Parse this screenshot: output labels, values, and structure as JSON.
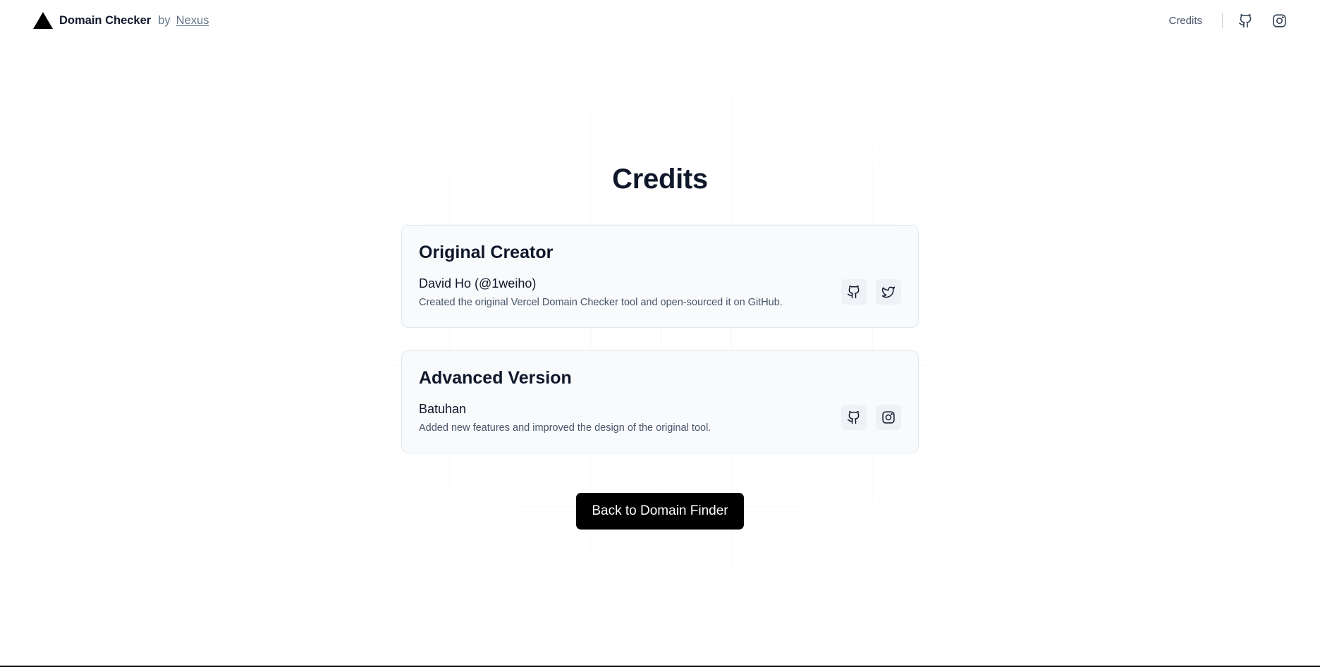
{
  "header": {
    "app_name": "Domain Checker",
    "by_text": "by",
    "author_link": "Nexus",
    "nav": {
      "credits_label": "Credits",
      "icons": [
        "github-icon",
        "instagram-icon"
      ]
    }
  },
  "main": {
    "title": "Credits",
    "cards": [
      {
        "heading": "Original Creator",
        "name": "David Ho (@1weiho)",
        "description": "Created the original Vercel Domain Checker tool and open-sourced it on GitHub.",
        "links": [
          "github-icon",
          "twitter-icon"
        ]
      },
      {
        "heading": "Advanced Version",
        "name": "Batuhan",
        "description": "Added new features and improved the design of the original tool.",
        "links": [
          "github-icon",
          "instagram-icon"
        ]
      }
    ],
    "back_button_label": "Back to Domain Finder"
  },
  "colors": {
    "text_primary": "#0f172a",
    "text_muted": "#64748b",
    "card_background": "#f8fafc",
    "card_border": "#e2e8f0",
    "button_background": "#000000",
    "button_text": "#ffffff"
  }
}
